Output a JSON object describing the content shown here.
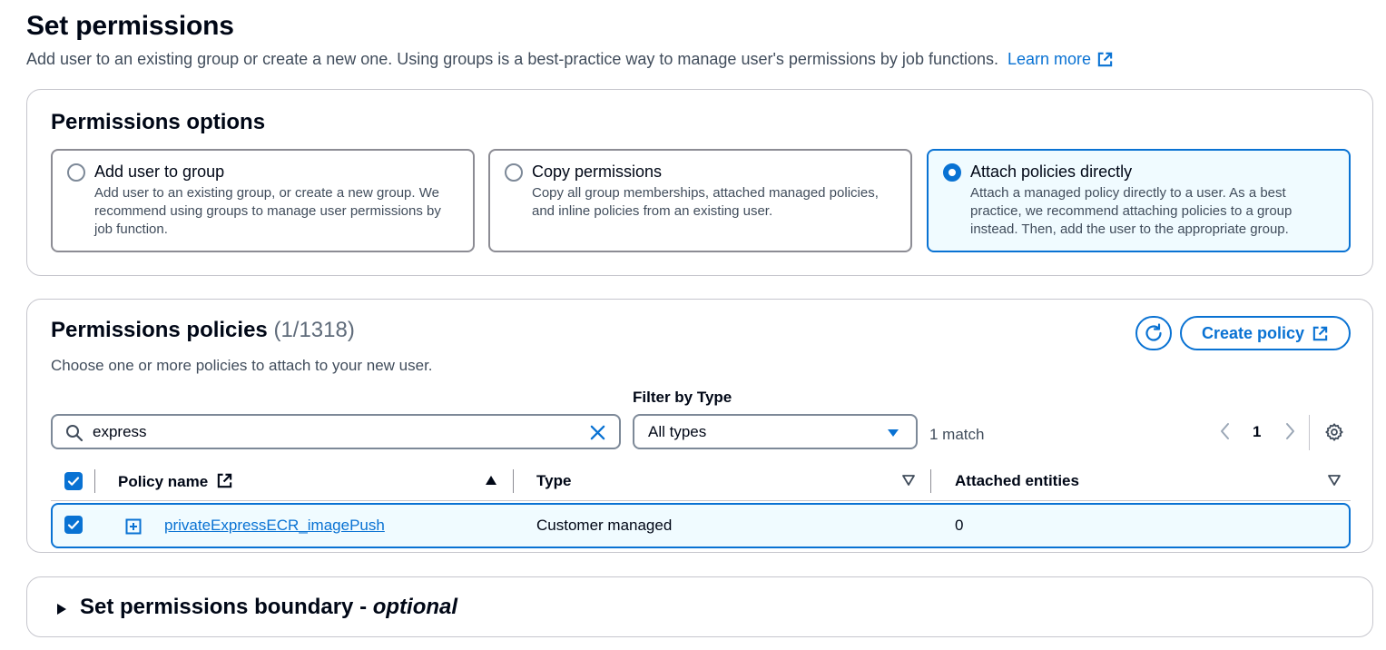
{
  "header": {
    "title": "Set permissions",
    "description": "Add user to an existing group or create a new one. Using groups is a best-practice way to manage user's permissions by job functions.",
    "learn_more": "Learn more"
  },
  "options": {
    "title": "Permissions options",
    "tiles": [
      {
        "label": "Add user to group",
        "description": "Add user to an existing group, or create a new group. We recommend using groups to manage user permissions by job function.",
        "selected": false
      },
      {
        "label": "Copy permissions",
        "description": "Copy all group memberships, attached managed policies, and inline policies from an existing user.",
        "selected": false
      },
      {
        "label": "Attach policies directly",
        "description": "Attach a managed policy directly to a user. As a best practice, we recommend attaching policies to a group instead. Then, add the user to the appropriate group.",
        "selected": true
      }
    ]
  },
  "policies": {
    "title": "Permissions policies",
    "count": "(1/1318)",
    "description": "Choose one or more policies to attach to your new user.",
    "create_policy": "Create policy",
    "search_value": "express",
    "filter_label": "Filter by Type",
    "filter_value": "All types",
    "match_count": "1 match",
    "page_number": "1",
    "columns": {
      "name": "Policy name",
      "type": "Type",
      "entities": "Attached entities"
    },
    "rows": [
      {
        "name": "privateExpressECR_imagePush",
        "type": "Customer managed",
        "entities": "0",
        "checked": true
      }
    ]
  },
  "boundary": {
    "title": "Set permissions boundary - ",
    "optional": "optional"
  },
  "colors": {
    "accent": "#0972d3",
    "selected_bg": "#f0fbff",
    "border": "#c6c6cd",
    "text": "#000716",
    "muted": "#414d5c"
  }
}
